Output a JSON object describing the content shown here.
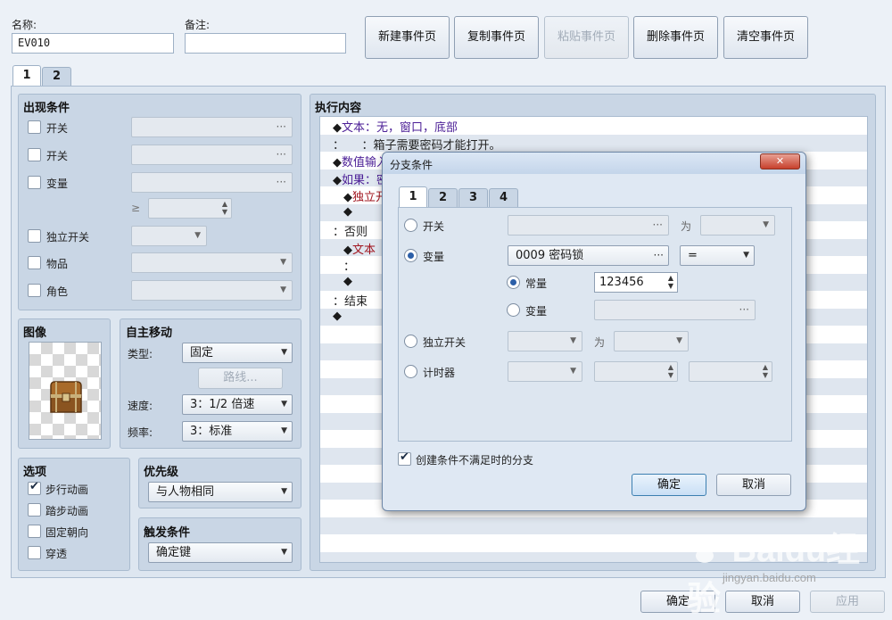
{
  "header": {
    "name_label": "名称:",
    "name_value": "EV010",
    "note_label": "备注:",
    "note_value": "",
    "buttons": {
      "new_page": "新建事件页",
      "copy_page": "复制事件页",
      "paste_page": "粘贴事件页",
      "delete_page": "删除事件页",
      "clear_page": "清空事件页"
    }
  },
  "page_tabs": [
    "1",
    "2"
  ],
  "conditions": {
    "title": "出现条件",
    "switch1": "开关",
    "switch2": "开关",
    "variable": "变量",
    "ge_symbol": "≥",
    "self_switch": "独立开关",
    "item": "物品",
    "actor": "角色"
  },
  "image": {
    "title": "图像",
    "graphic": "treasure-chest"
  },
  "autonomous": {
    "title": "自主移动",
    "type_label": "类型:",
    "type_value": "固定",
    "route_button": "路线...",
    "speed_label": "速度:",
    "speed_value": "3：1/2 倍速",
    "freq_label": "频率:",
    "freq_value": "3：标准"
  },
  "options": {
    "title": "选项",
    "items": [
      {
        "label": "步行动画",
        "checked": true
      },
      {
        "label": "踏步动画",
        "checked": false
      },
      {
        "label": "固定朝向",
        "checked": false
      },
      {
        "label": "穿透",
        "checked": false
      }
    ]
  },
  "priority": {
    "title": "优先级",
    "value": "与人物相同"
  },
  "trigger": {
    "title": "触发条件",
    "value": "确定键"
  },
  "contents": {
    "title": "执行内容",
    "lines": [
      {
        "prefix": "◆",
        "text": "文本：无，窗口，底部",
        "indent": 0
      },
      {
        "prefix": "：",
        "text": "　　：箱子需要密码才能打开。",
        "indent": 0
      },
      {
        "prefix": "◆",
        "text": "数值输入",
        "indent": 0
      },
      {
        "prefix": "◆",
        "text": "如果：密",
        "indent": 0
      },
      {
        "prefix": "◆",
        "text": "独立开",
        "indent": 1
      },
      {
        "prefix": "◆",
        "text": "",
        "indent": 1
      },
      {
        "prefix": "：",
        "text": "否则",
        "indent": 0
      },
      {
        "prefix": "◆",
        "text": "文本",
        "indent": 1
      },
      {
        "prefix": "：",
        "text": "",
        "indent": 1
      },
      {
        "prefix": "◆",
        "text": "",
        "indent": 1
      },
      {
        "prefix": "：",
        "text": "结束",
        "indent": 0
      },
      {
        "prefix": "◆",
        "text": "",
        "indent": 0
      }
    ]
  },
  "footer": {
    "ok": "确定",
    "cancel": "取消",
    "apply": "应用"
  },
  "dialog": {
    "title": "分支条件",
    "close": "✕",
    "tabs": [
      "1",
      "2",
      "3",
      "4"
    ],
    "switch_label": "开关",
    "is_label": "为",
    "variable_label": "变量",
    "variable_value": "0009 密码锁",
    "operator": "=",
    "constant_label": "常量",
    "constant_value": "123456",
    "var_label": "变量",
    "self_switch_label": "独立开关",
    "is_label2": "为",
    "timer_label": "计时器",
    "else_branch_label": "创建条件不满足时的分支",
    "ok": "确定",
    "cancel": "取消"
  },
  "watermark": {
    "brand": "Baidu经验",
    "url": "jingyan.baidu.com"
  }
}
